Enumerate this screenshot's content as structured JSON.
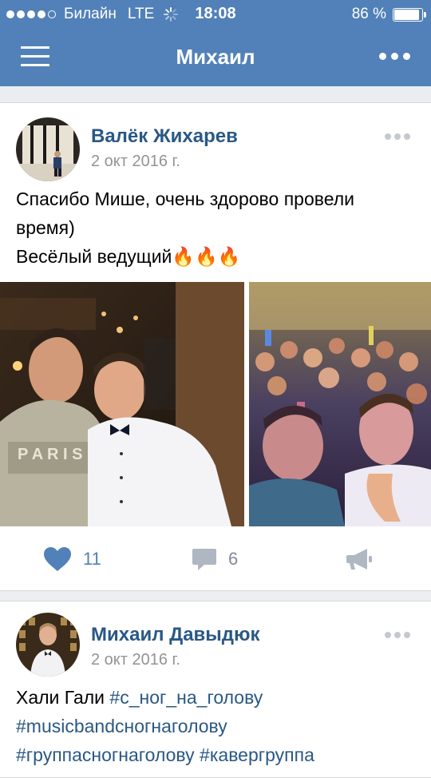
{
  "status_bar": {
    "carrier": "Билайн",
    "network": "LTE",
    "time": "18:08",
    "battery": "86 %",
    "battery_level": 0.86
  },
  "nav": {
    "title": "Михаил"
  },
  "posts": [
    {
      "author": "Валёк Жихарев",
      "date": "2 окт 2016 г.",
      "text_lines": [
        "Спасибо Мише, очень здорово провели",
        "время)",
        "Весёлый ведущий"
      ],
      "emoji": "🔥🔥🔥",
      "likes": "11",
      "comments": "6"
    },
    {
      "author": "Михаил Давыдюк",
      "date": "2 окт 2016 г.",
      "text_prefix": "Хали Гали ",
      "hashtags": [
        "#с_ног_на_голову",
        "#musicbandсногнаголову",
        "#группасногнаголову",
        "#кавергруппа"
      ]
    }
  ],
  "colors": {
    "header": "#5181b8",
    "link": "#2a5885",
    "like_active": "#5181b8",
    "meta": "#939393"
  }
}
